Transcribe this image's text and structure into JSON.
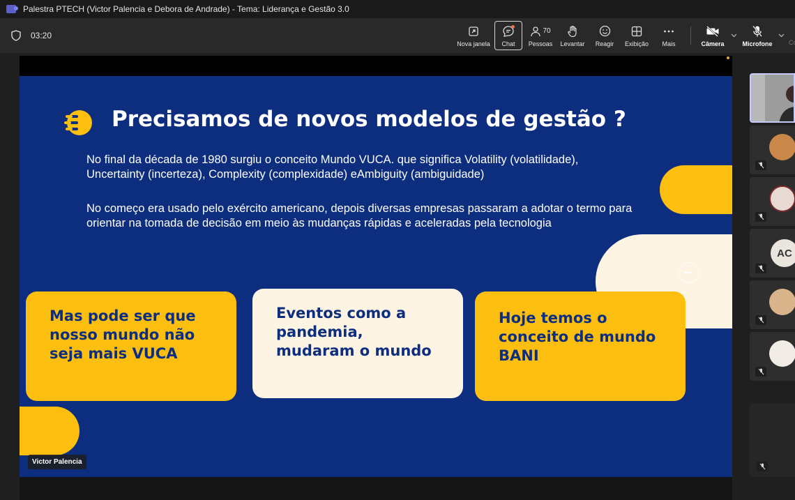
{
  "window": {
    "title": "Palestra PTECH (Victor Palencia e Debora de Andrade) - Tema: Liderança e Gestão 3.0"
  },
  "toolbar": {
    "timer": "03:20",
    "items": [
      {
        "label": "Nova janela",
        "icon": "popout-icon"
      },
      {
        "label": "Chat",
        "icon": "chat-icon"
      },
      {
        "label": "Pessoas",
        "icon": "people-icon",
        "count": "70"
      },
      {
        "label": "Levantar",
        "icon": "raise-hand-icon"
      },
      {
        "label": "Reagir",
        "icon": "smiley-icon"
      },
      {
        "label": "Exibição",
        "icon": "grid-icon"
      },
      {
        "label": "Mais",
        "icon": "more-icon"
      },
      {
        "label": "Câmera",
        "icon": "camera-off-icon"
      },
      {
        "label": "Microfone",
        "icon": "mic-off-icon"
      }
    ],
    "cutoff_label": "Co"
  },
  "slide": {
    "title": "Precisamos de novos modelos de gestão ?",
    "paragraph1": "No final da década de 1980 surgiu o conceito Mundo VUCA. que significa Volatility (volatilidade), Uncertainty (incerteza), Complexity (complexidade) eAmbiguity (ambiguidade)",
    "paragraph2": "No começo era usado pelo exército americano, depois diversas empresas passaram a adotar o termo para orientar na tomada de decisão em meio às mudanças rápidas e aceleradas pela tecnologia",
    "cards": [
      {
        "lines": [
          "Mas pode ser que",
          "nosso mundo não",
          "seja mais VUCA"
        ]
      },
      {
        "lines": [
          "Eventos como a",
          "pandemia,",
          "mudaram o mundo"
        ]
      },
      {
        "lines": [
          "Hoje temos o",
          "conceito de mundo",
          "BANI"
        ]
      }
    ],
    "colors": {
      "background": "#0d2d7f",
      "yellow": "#fcbf0f",
      "cream": "#fdf4e3"
    }
  },
  "presenter": {
    "name": "Victor Palencia"
  },
  "participants": {
    "initials_tile": "AC"
  }
}
